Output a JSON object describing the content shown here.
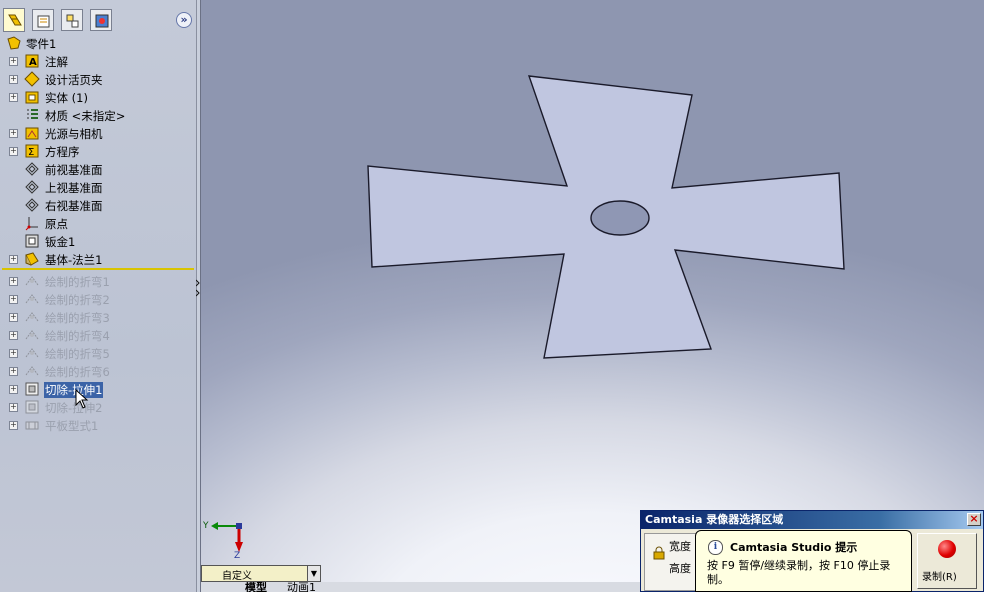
{
  "feature_manager": {
    "tabs": [
      "feature-manager-tab",
      "property-manager-tab",
      "configuration-manager-tab",
      "display-manager-tab"
    ],
    "collapse_label": "»",
    "root": "零件1",
    "items": [
      {
        "label": "注解",
        "icon": "annotation-icon",
        "expandable": true,
        "state": "normal"
      },
      {
        "label": "设计活页夹",
        "icon": "design-binder-icon",
        "expandable": true,
        "state": "normal"
      },
      {
        "label": "实体 (1)",
        "icon": "solid-bodies-icon",
        "expandable": true,
        "state": "normal"
      },
      {
        "label": "材质 <未指定>",
        "icon": "material-icon",
        "expandable": false,
        "state": "normal"
      },
      {
        "label": "光源与相机",
        "icon": "lights-cameras-icon",
        "expandable": true,
        "state": "normal"
      },
      {
        "label": "方程序",
        "icon": "equations-icon",
        "expandable": true,
        "state": "normal"
      },
      {
        "label": "前视基准面",
        "icon": "plane-icon",
        "expandable": false,
        "state": "normal"
      },
      {
        "label": "上视基准面",
        "icon": "plane-icon",
        "expandable": false,
        "state": "normal"
      },
      {
        "label": "右视基准面",
        "icon": "plane-icon",
        "expandable": false,
        "state": "normal"
      },
      {
        "label": "原点",
        "icon": "origin-icon",
        "expandable": false,
        "state": "normal"
      },
      {
        "label": "钣金1",
        "icon": "sheet-metal-icon",
        "expandable": false,
        "state": "normal"
      },
      {
        "label": "基体-法兰1",
        "icon": "base-flange-icon",
        "expandable": true,
        "state": "normal"
      },
      {
        "label": "绘制的折弯1",
        "icon": "sketched-bend-icon",
        "expandable": true,
        "state": "suppressed"
      },
      {
        "label": "绘制的折弯2",
        "icon": "sketched-bend-icon",
        "expandable": true,
        "state": "suppressed"
      },
      {
        "label": "绘制的折弯3",
        "icon": "sketched-bend-icon",
        "expandable": true,
        "state": "suppressed"
      },
      {
        "label": "绘制的折弯4",
        "icon": "sketched-bend-icon",
        "expandable": true,
        "state": "suppressed"
      },
      {
        "label": "绘制的折弯5",
        "icon": "sketched-bend-icon",
        "expandable": true,
        "state": "suppressed"
      },
      {
        "label": "绘制的折弯6",
        "icon": "sketched-bend-icon",
        "expandable": true,
        "state": "suppressed"
      },
      {
        "label": "切除-拉伸1",
        "icon": "cut-extrude-icon",
        "expandable": true,
        "state": "selected"
      },
      {
        "label": "切除-拉伸2",
        "icon": "cut-extrude-icon",
        "expandable": true,
        "state": "suppressed"
      },
      {
        "label": "平板型式1",
        "icon": "flat-pattern-icon",
        "expandable": true,
        "state": "suppressed"
      }
    ]
  },
  "viewport": {
    "triad_labels": {
      "y": "Y",
      "z": "Z"
    },
    "view_dropdown": "自定义",
    "bottom_tabs": [
      "模型",
      "动画1"
    ]
  },
  "camtasia": {
    "title": "Camtasia 录像器选择区域",
    "width_label": "宽度",
    "height_label": "高度",
    "record_label": "录制(R)",
    "tooltip_title": "Camtasia Studio 提示",
    "tooltip_body": "按 F9 暂停/继续录制，按 F10 停止录制。"
  },
  "colors": {
    "selection": "#3b63a7",
    "rollback_bar": "#d9c400",
    "part_face": "#c0c6e0",
    "titlebar": "#0a246a"
  }
}
